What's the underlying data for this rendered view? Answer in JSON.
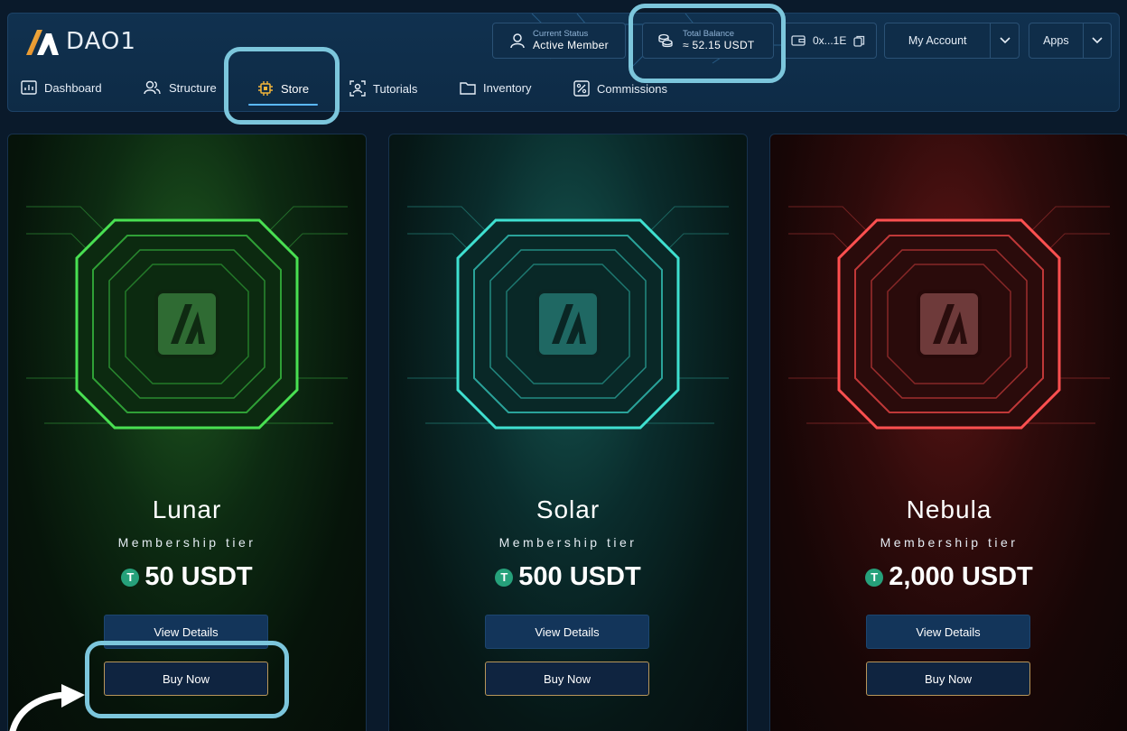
{
  "brand": {
    "name": "DAO1"
  },
  "header": {
    "status": {
      "label": "Current Status",
      "value": "Active Member"
    },
    "balance": {
      "label": "Total Balance",
      "value": "≈ 52.15 USDT"
    },
    "wallet": {
      "address": "0x...1E"
    },
    "account_label": "My Account",
    "apps_label": "Apps"
  },
  "nav": [
    {
      "label": "Dashboard",
      "icon": "dashboard-icon"
    },
    {
      "label": "Structure",
      "icon": "users-icon"
    },
    {
      "label": "Store",
      "icon": "chip-icon",
      "active": true
    },
    {
      "label": "Tutorials",
      "icon": "tutorials-icon"
    },
    {
      "label": "Inventory",
      "icon": "folder-icon"
    },
    {
      "label": "Commissions",
      "icon": "percent-icon"
    }
  ],
  "tiers": [
    {
      "name": "Lunar",
      "subtitle": "Membership tier",
      "price": "50 USDT",
      "accent": "#3ee04a",
      "details_label": "View Details",
      "buy_label": "Buy Now"
    },
    {
      "name": "Solar",
      "subtitle": "Membership tier",
      "price": "500 USDT",
      "accent": "#35d6c7",
      "details_label": "View Details",
      "buy_label": "Buy Now"
    },
    {
      "name": "Nebula",
      "subtitle": "Membership tier",
      "price": "2,000 USDT",
      "accent": "#ff4a4a",
      "details_label": "View Details",
      "buy_label": "Buy Now"
    }
  ],
  "colors": {
    "highlight_ring": "#7cc6dc",
    "buy_border": "#b8965a",
    "tether": "#26a17b"
  }
}
